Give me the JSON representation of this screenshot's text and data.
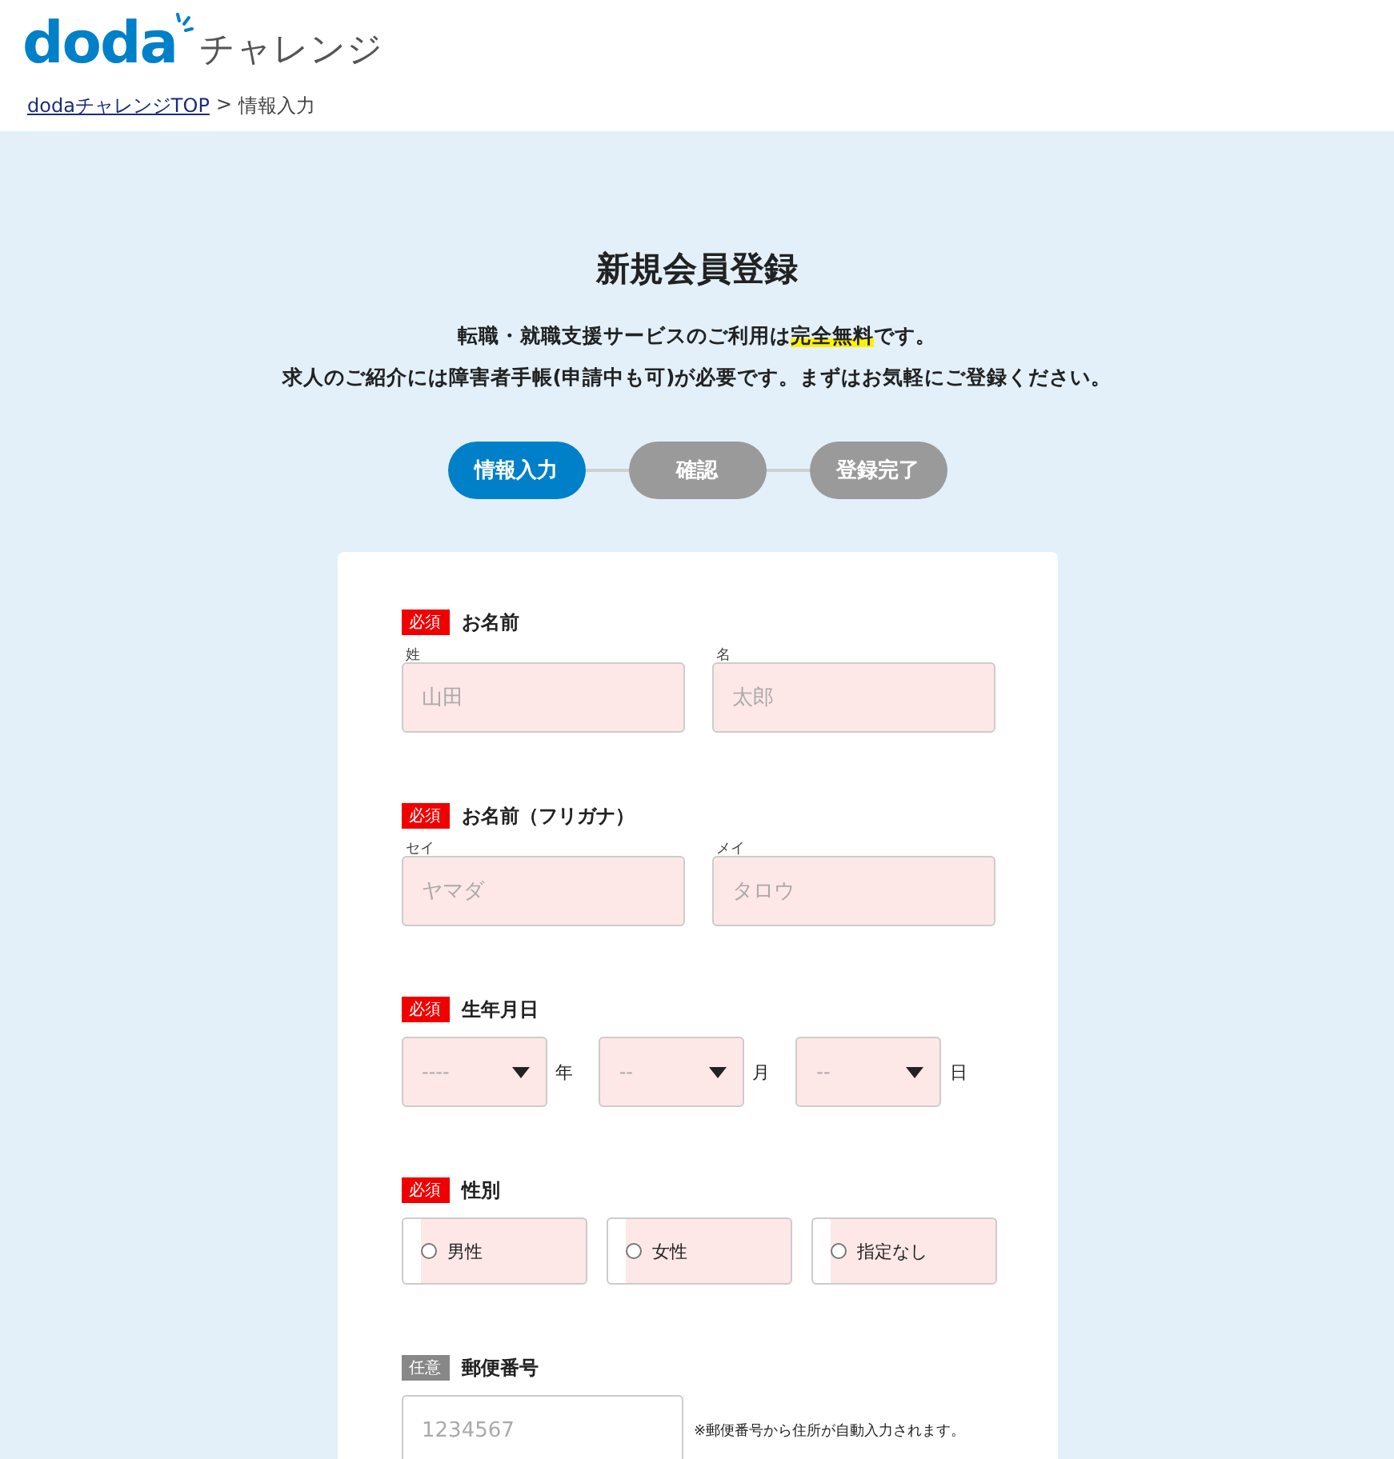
{
  "header": {
    "logo_wordmark": "doda",
    "logo_suffix": "チャレンジ",
    "breadcrumb": [
      {
        "label": "dodaチャレンジTOP",
        "link": true
      },
      {
        "label": "情報入力",
        "link": false
      }
    ],
    "breadcrumb_separator": ">"
  },
  "title": "新規会員登録",
  "intro": [
    "転職・就職支援サービスのご利用は**完全無料**です。",
    "求人のご紹介には障害者手帳(申請中も可)が必要です。まずはお気軽にご登録ください。"
  ],
  "steps": [
    {
      "label": "情報入力",
      "selected": true
    },
    {
      "label": "確認",
      "selected": false
    },
    {
      "label": "登録完了",
      "selected": false
    }
  ],
  "sections": [
    {
      "kind": "text_pair",
      "badge": "必須",
      "required": true,
      "label": "お名前",
      "fields": [
        {
          "caption": "姓",
          "placeholder": "山田"
        },
        {
          "caption": "名",
          "placeholder": "太郎"
        }
      ]
    },
    {
      "kind": "text_pair",
      "badge": "必須",
      "required": true,
      "label": "お名前（フリガナ）",
      "fields": [
        {
          "caption": "セイ",
          "placeholder": "ヤマダ"
        },
        {
          "caption": "メイ",
          "placeholder": "タロウ"
        }
      ]
    },
    {
      "kind": "date",
      "badge": "必須",
      "required": true,
      "label": "生年月日",
      "selects": [
        {
          "value": "----",
          "unit": "年"
        },
        {
          "value": "--",
          "unit": "月"
        },
        {
          "value": "--",
          "unit": "日"
        }
      ]
    },
    {
      "kind": "radio",
      "badge": "必須",
      "required": true,
      "label": "性別",
      "options": [
        {
          "label": "男性",
          "selected": false
        },
        {
          "label": "女性",
          "selected": false
        },
        {
          "label": "指定なし",
          "selected": false
        }
      ]
    },
    {
      "kind": "zip",
      "badge": "任意",
      "required": false,
      "label": "郵便番号",
      "placeholder": "1234567",
      "note": "※郵便番号から住所が自動入力されます。"
    }
  ]
}
